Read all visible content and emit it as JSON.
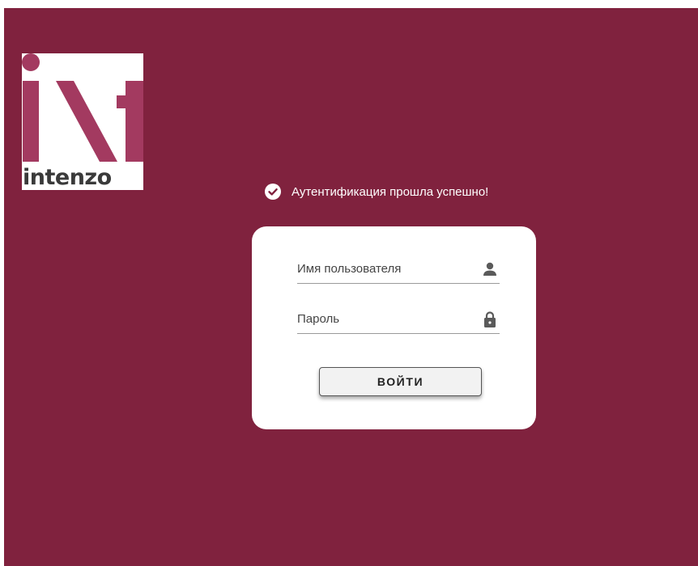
{
  "logo": {
    "wordmark": "intenzo",
    "accent_color": "#a33a60",
    "text_color": "#3a3a3a"
  },
  "alert": {
    "icon": "check-circle-icon",
    "message": "Аутентификация прошла успешно!"
  },
  "login_form": {
    "username": {
      "value": "",
      "placeholder": "Имя пользователя",
      "icon": "user-icon"
    },
    "password": {
      "value": "",
      "placeholder": "Пароль",
      "icon": "lock-icon"
    },
    "submit_label": "ВОЙТИ"
  },
  "colors": {
    "background": "#80223e",
    "card": "#ffffff",
    "icon": "#5a5a5a"
  }
}
